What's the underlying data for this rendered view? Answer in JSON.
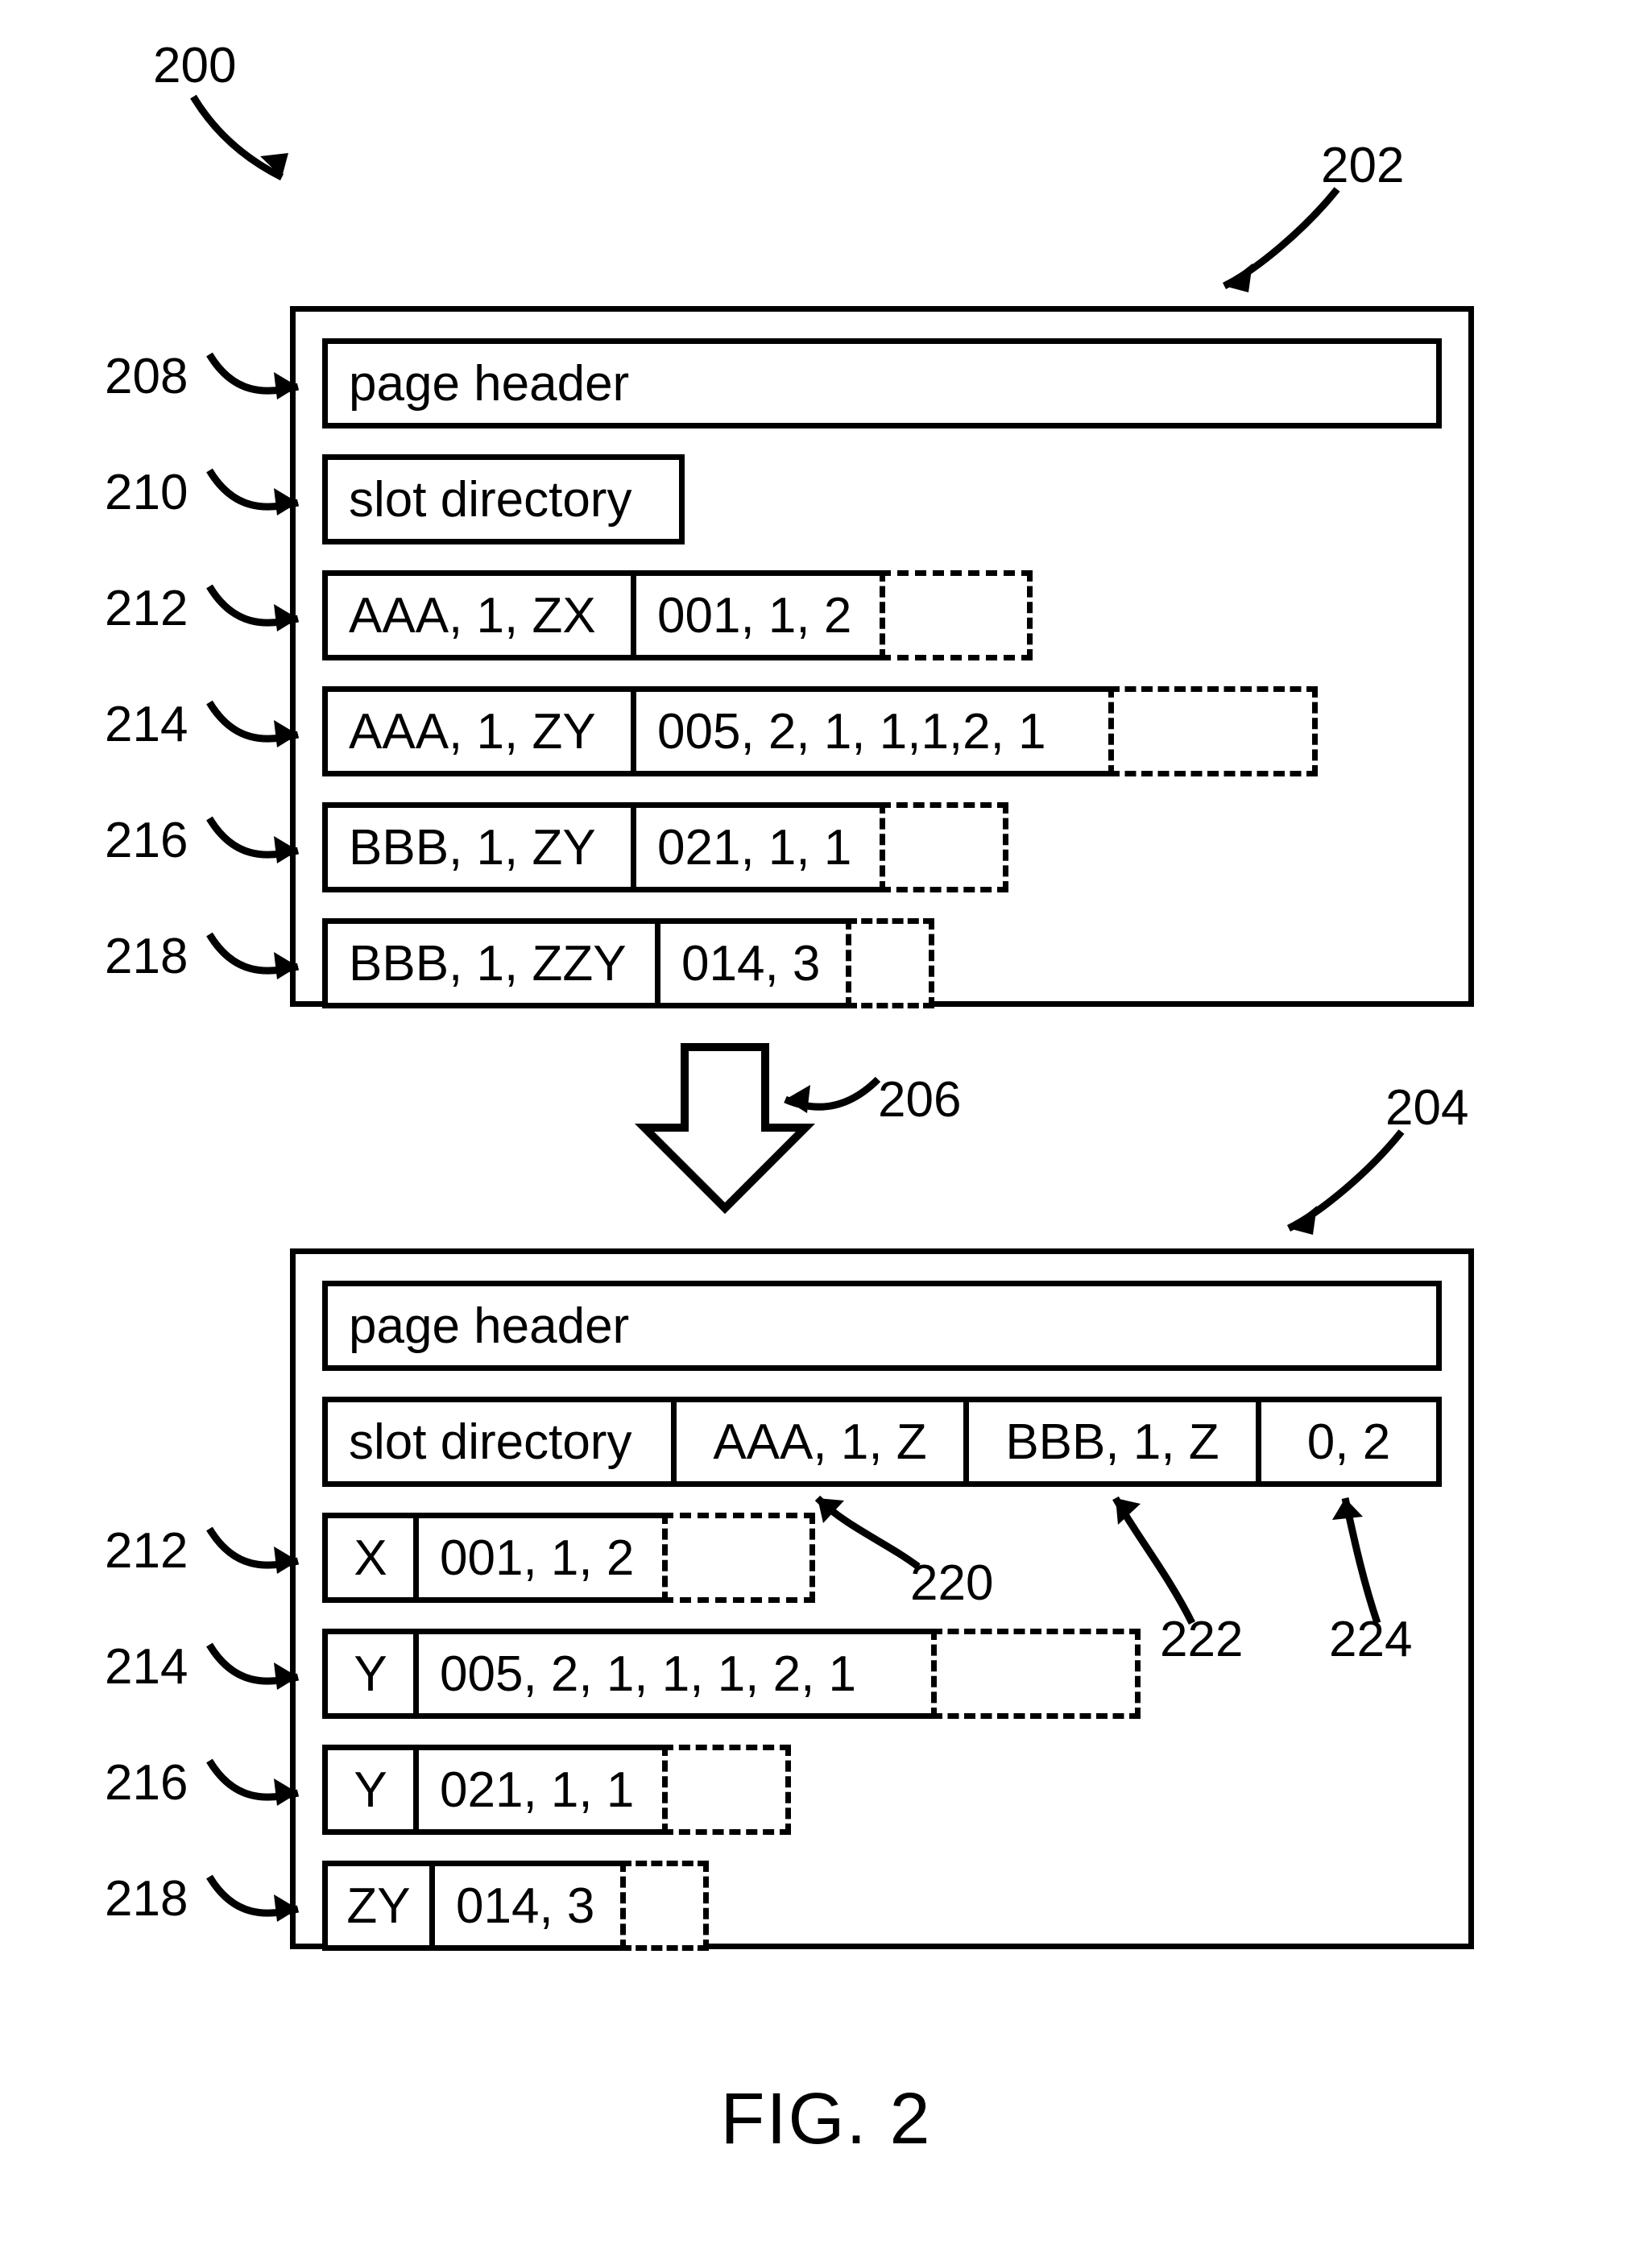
{
  "figure_label": "FIG. 2",
  "refs": {
    "r200": "200",
    "r202": "202",
    "r204": "204",
    "r206": "206",
    "r208": "208",
    "r210": "210",
    "r212": "212",
    "r214": "214",
    "r216": "216",
    "r218": "218",
    "r220": "220",
    "r222": "222",
    "r224": "224"
  },
  "top": {
    "page_header": "page header",
    "slot_directory": "slot directory",
    "rows": [
      {
        "key": "AAA, 1, ZX",
        "val": "001, 1, 2"
      },
      {
        "key": "AAA, 1, ZY",
        "val": "005, 2, 1, 1,1,2, 1"
      },
      {
        "key": "BBB, 1, ZY",
        "val": "021, 1, 1"
      },
      {
        "key": "BBB, 1, ZZY",
        "val": "014, 3"
      }
    ]
  },
  "bottom": {
    "page_header": "page header",
    "slot_directory": "slot directory",
    "dir_entries": [
      "AAA, 1, Z",
      "BBB, 1, Z",
      "0, 2"
    ],
    "rows": [
      {
        "key": "X",
        "val": "001, 1, 2"
      },
      {
        "key": "Y",
        "val": "005, 2, 1, 1, 1, 2, 1"
      },
      {
        "key": "Y",
        "val": "021, 1, 1"
      },
      {
        "key": "ZY",
        "val": "014, 3"
      }
    ]
  }
}
